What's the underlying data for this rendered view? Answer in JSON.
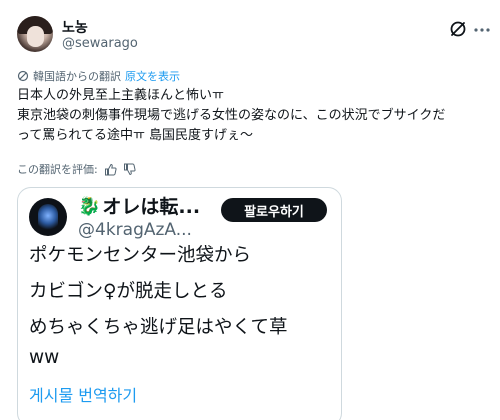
{
  "author": {
    "display_name": "노농",
    "handle": "@sewarago"
  },
  "translation": {
    "note": "韓国語からの翻訳",
    "show_original": "原文を表示"
  },
  "post": {
    "line1": "日本人の外見至上主義ほんと怖いㅠ",
    "line2": "東京池袋の刺傷事件現場で逃げる女性の姿なのに、この状況でブサイクだ",
    "line3": "って罵られてる途中ㅠ 島国民度すげぇ〜"
  },
  "rate": {
    "label": "この翻訳を評価:"
  },
  "quote": {
    "snake_emoji": "🐉",
    "name": "オレは転...",
    "handle": "@4kragAzA...",
    "follow_label": "팔로우하기",
    "lines": [
      "ポケモンセンター池袋から",
      "カビゴン♀が脱走しとる",
      "めちゃくちゃ逃げ足はやくて草",
      "ww"
    ],
    "translate_label": "게시물 번역하기"
  },
  "colors": {
    "text": "#0f1419",
    "secondary": "#536471",
    "link": "#1d9bf0",
    "border": "#cfd9de"
  }
}
